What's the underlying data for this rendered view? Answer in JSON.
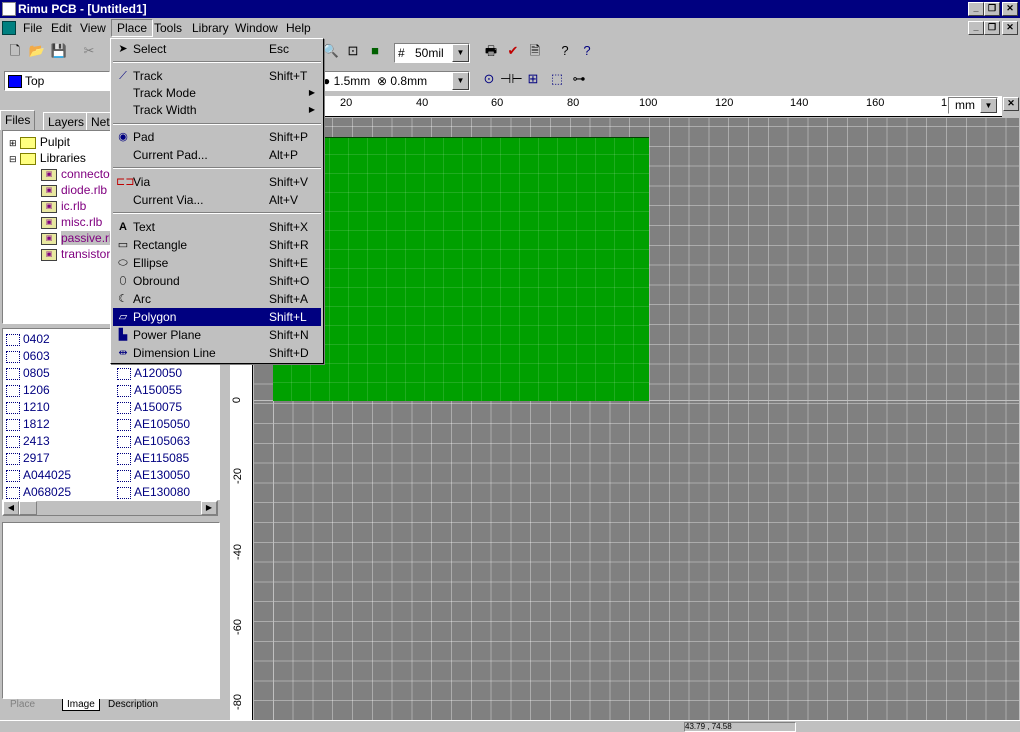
{
  "window": {
    "title": "Rimu PCB - [Untitled1]"
  },
  "menubar": [
    "File",
    "Edit",
    "View",
    "Place",
    "Tools",
    "Library",
    "Window",
    "Help"
  ],
  "toolbar": {
    "grid_value": "50mil",
    "layer": "Top",
    "track_width": "1.5mm",
    "via_size": "0.8mm",
    "units": "mm"
  },
  "left_panel": {
    "tabs": [
      "Files",
      "Layers",
      "Net"
    ],
    "tree": [
      "Pulpit",
      "Libraries",
      "connecto",
      "diode.rlb",
      "ic.rlb",
      "misc.rlb",
      "passive.rl",
      "transistor."
    ],
    "parts_col1": [
      "0402",
      "0603",
      "0805",
      "1206",
      "1210",
      "1812",
      "2413",
      "2917",
      "A044025",
      "A068025"
    ],
    "parts_col2": [
      "A120050",
      "A150055",
      "A150075",
      "AE105050",
      "AE105063",
      "AE115085",
      "AE130050",
      "AE130080"
    ],
    "bottom_tabs": [
      "Place",
      "Image",
      "Description"
    ]
  },
  "ruler": {
    "h_labels": [
      "20",
      "40",
      "60",
      "80",
      "100",
      "120",
      "140",
      "160",
      "1"
    ],
    "v_labels": [
      "0",
      "-20",
      "-40",
      "-60",
      "-80"
    ]
  },
  "place_menu": {
    "items": [
      {
        "label": "Select",
        "key": "Esc",
        "icon": "arrow-icon"
      },
      {
        "label": "Track",
        "key": "Shift+T",
        "icon": "track-icon"
      },
      {
        "label": "Track Mode",
        "key": "",
        "icon": "",
        "submenu": true
      },
      {
        "label": "Track Width",
        "key": "",
        "icon": "",
        "submenu": true
      },
      {
        "label": "Pad",
        "key": "Shift+P",
        "icon": "pad-icon"
      },
      {
        "label": "Current Pad...",
        "key": "Alt+P",
        "icon": ""
      },
      {
        "label": "Via",
        "key": "Shift+V",
        "icon": "via-icon"
      },
      {
        "label": "Current Via...",
        "key": "Alt+V",
        "icon": ""
      },
      {
        "label": "Text",
        "key": "Shift+X",
        "icon": "text-icon"
      },
      {
        "label": "Rectangle",
        "key": "Shift+R",
        "icon": "rectangle-icon"
      },
      {
        "label": "Ellipse",
        "key": "Shift+E",
        "icon": "ellipse-icon"
      },
      {
        "label": "Obround",
        "key": "Shift+O",
        "icon": "obround-icon"
      },
      {
        "label": "Arc",
        "key": "Shift+A",
        "icon": "arc-icon"
      },
      {
        "label": "Polygon",
        "key": "Shift+L",
        "icon": "polygon-icon"
      },
      {
        "label": "Power Plane",
        "key": "Shift+N",
        "icon": "power-plane-icon"
      },
      {
        "label": "Dimension Line",
        "key": "Shift+D",
        "icon": "dimension-icon"
      }
    ],
    "selected": "Polygon"
  },
  "status": {
    "coords": "43.79 , 74.58"
  }
}
